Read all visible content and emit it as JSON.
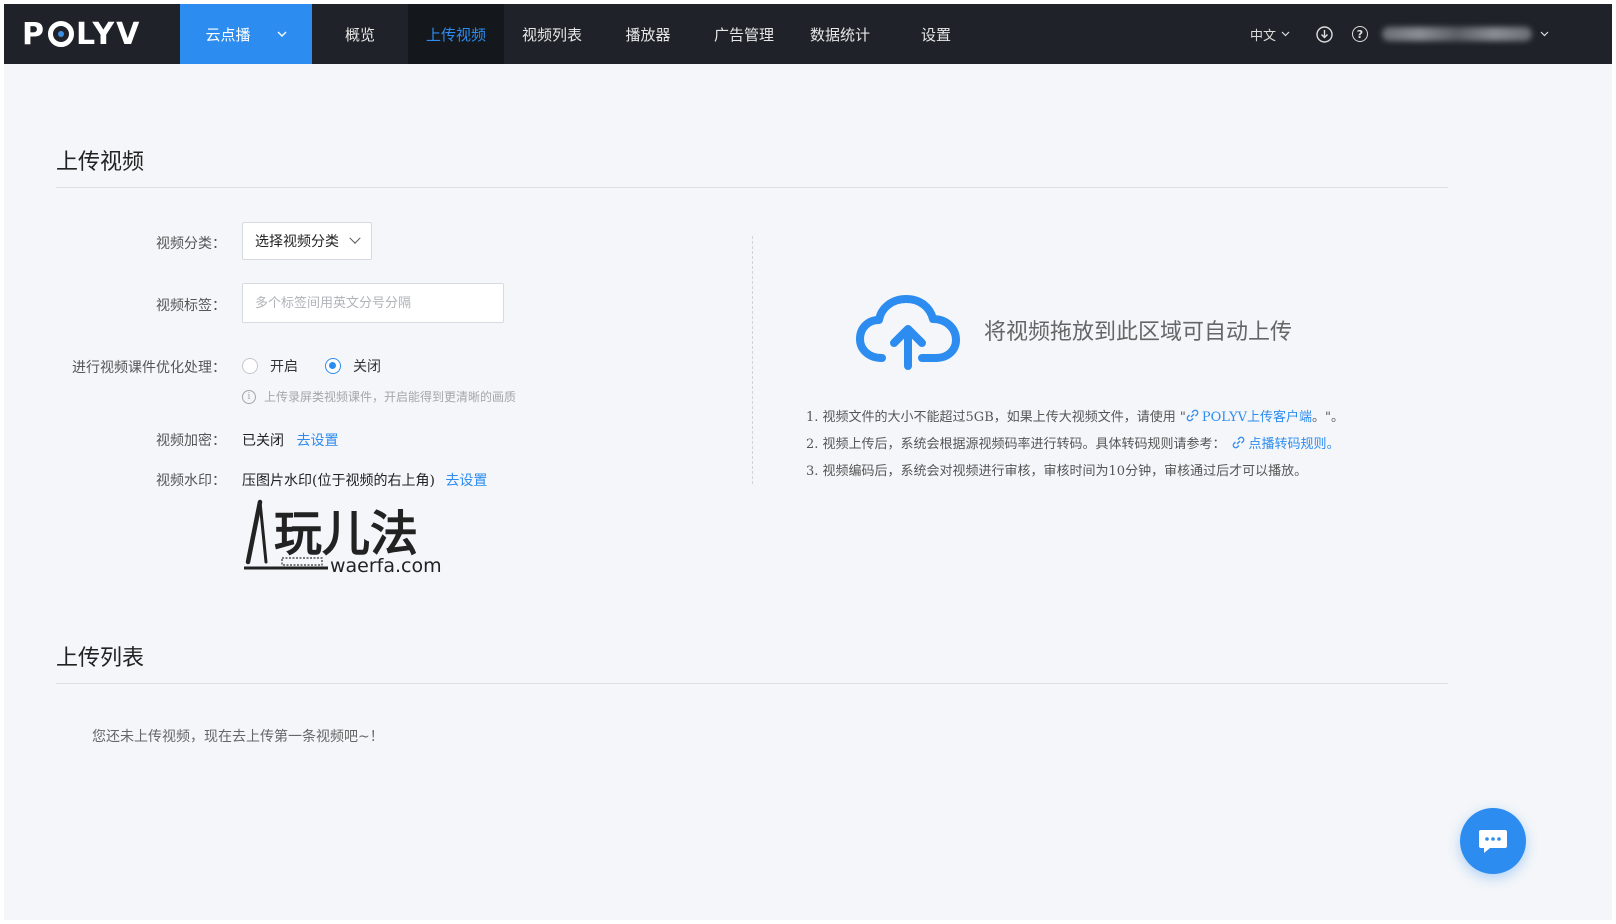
{
  "nav": {
    "vod_label": "云点播",
    "items": [
      {
        "label": "概览"
      },
      {
        "label": "上传视频"
      },
      {
        "label": "视频列表"
      },
      {
        "label": "播放器"
      },
      {
        "label": "广告管理"
      },
      {
        "label": "数据统计"
      },
      {
        "label": "设置"
      }
    ],
    "active_item": "上传视频",
    "language": "中文"
  },
  "logo": {
    "text": "POLYV"
  },
  "upload_section": {
    "title": "上传视频",
    "category_label": "视频分类：",
    "category_value": "选择视频分类",
    "tags_label": "视频标签：",
    "tags_placeholder": "多个标签间用英文分号分隔",
    "tags_value": "",
    "optimize_label": "进行视频课件优化处理：",
    "optimize_options": [
      "开启",
      "关闭"
    ],
    "optimize_selected": "关闭",
    "optimize_hint": "上传录屏类视频课件，开启能得到更清晰的画质",
    "encrypt_label": "视频加密：",
    "encrypt_value": "已关闭",
    "encrypt_link": "去设置",
    "watermark_label": "视频水印：",
    "watermark_value": "压图片水印(位于视频的右上角)",
    "watermark_link": "去设置",
    "watermark_image_text": "玩儿法",
    "watermark_image_domain": "waerfa.com"
  },
  "dropzone": {
    "text": "将视频拖放到此区域可自动上传",
    "note1_prefix": "1. 视频文件的大小不能超过5GB，如果上传大视频文件，请使用 \"",
    "note1_link": "POLYV上传客户端",
    "note1_suffix": "。\"。",
    "note2_prefix": "2. 视频上传后，系统会根据源视频码率进行转码。具体转码规则请参考：",
    "note2_link": "点播转码规则",
    "note2_suffix": "。",
    "note3": "3. 视频编码后，系统会对视频进行审核，审核时间为10分钟，审核通过后才可以播放。"
  },
  "list_section": {
    "title": "上传列表",
    "empty_text": "您还未上传视频，现在去上传第一条视频吧~！"
  },
  "colors": {
    "accent": "#2d8cf0",
    "nav_bg": "#1f2329",
    "page_bg": "#f4f6f9"
  },
  "icons": [
    "chevron-down-icon",
    "download-icon",
    "help-icon",
    "info-icon",
    "cloud-upload-icon",
    "link-icon",
    "chat-icon"
  ]
}
